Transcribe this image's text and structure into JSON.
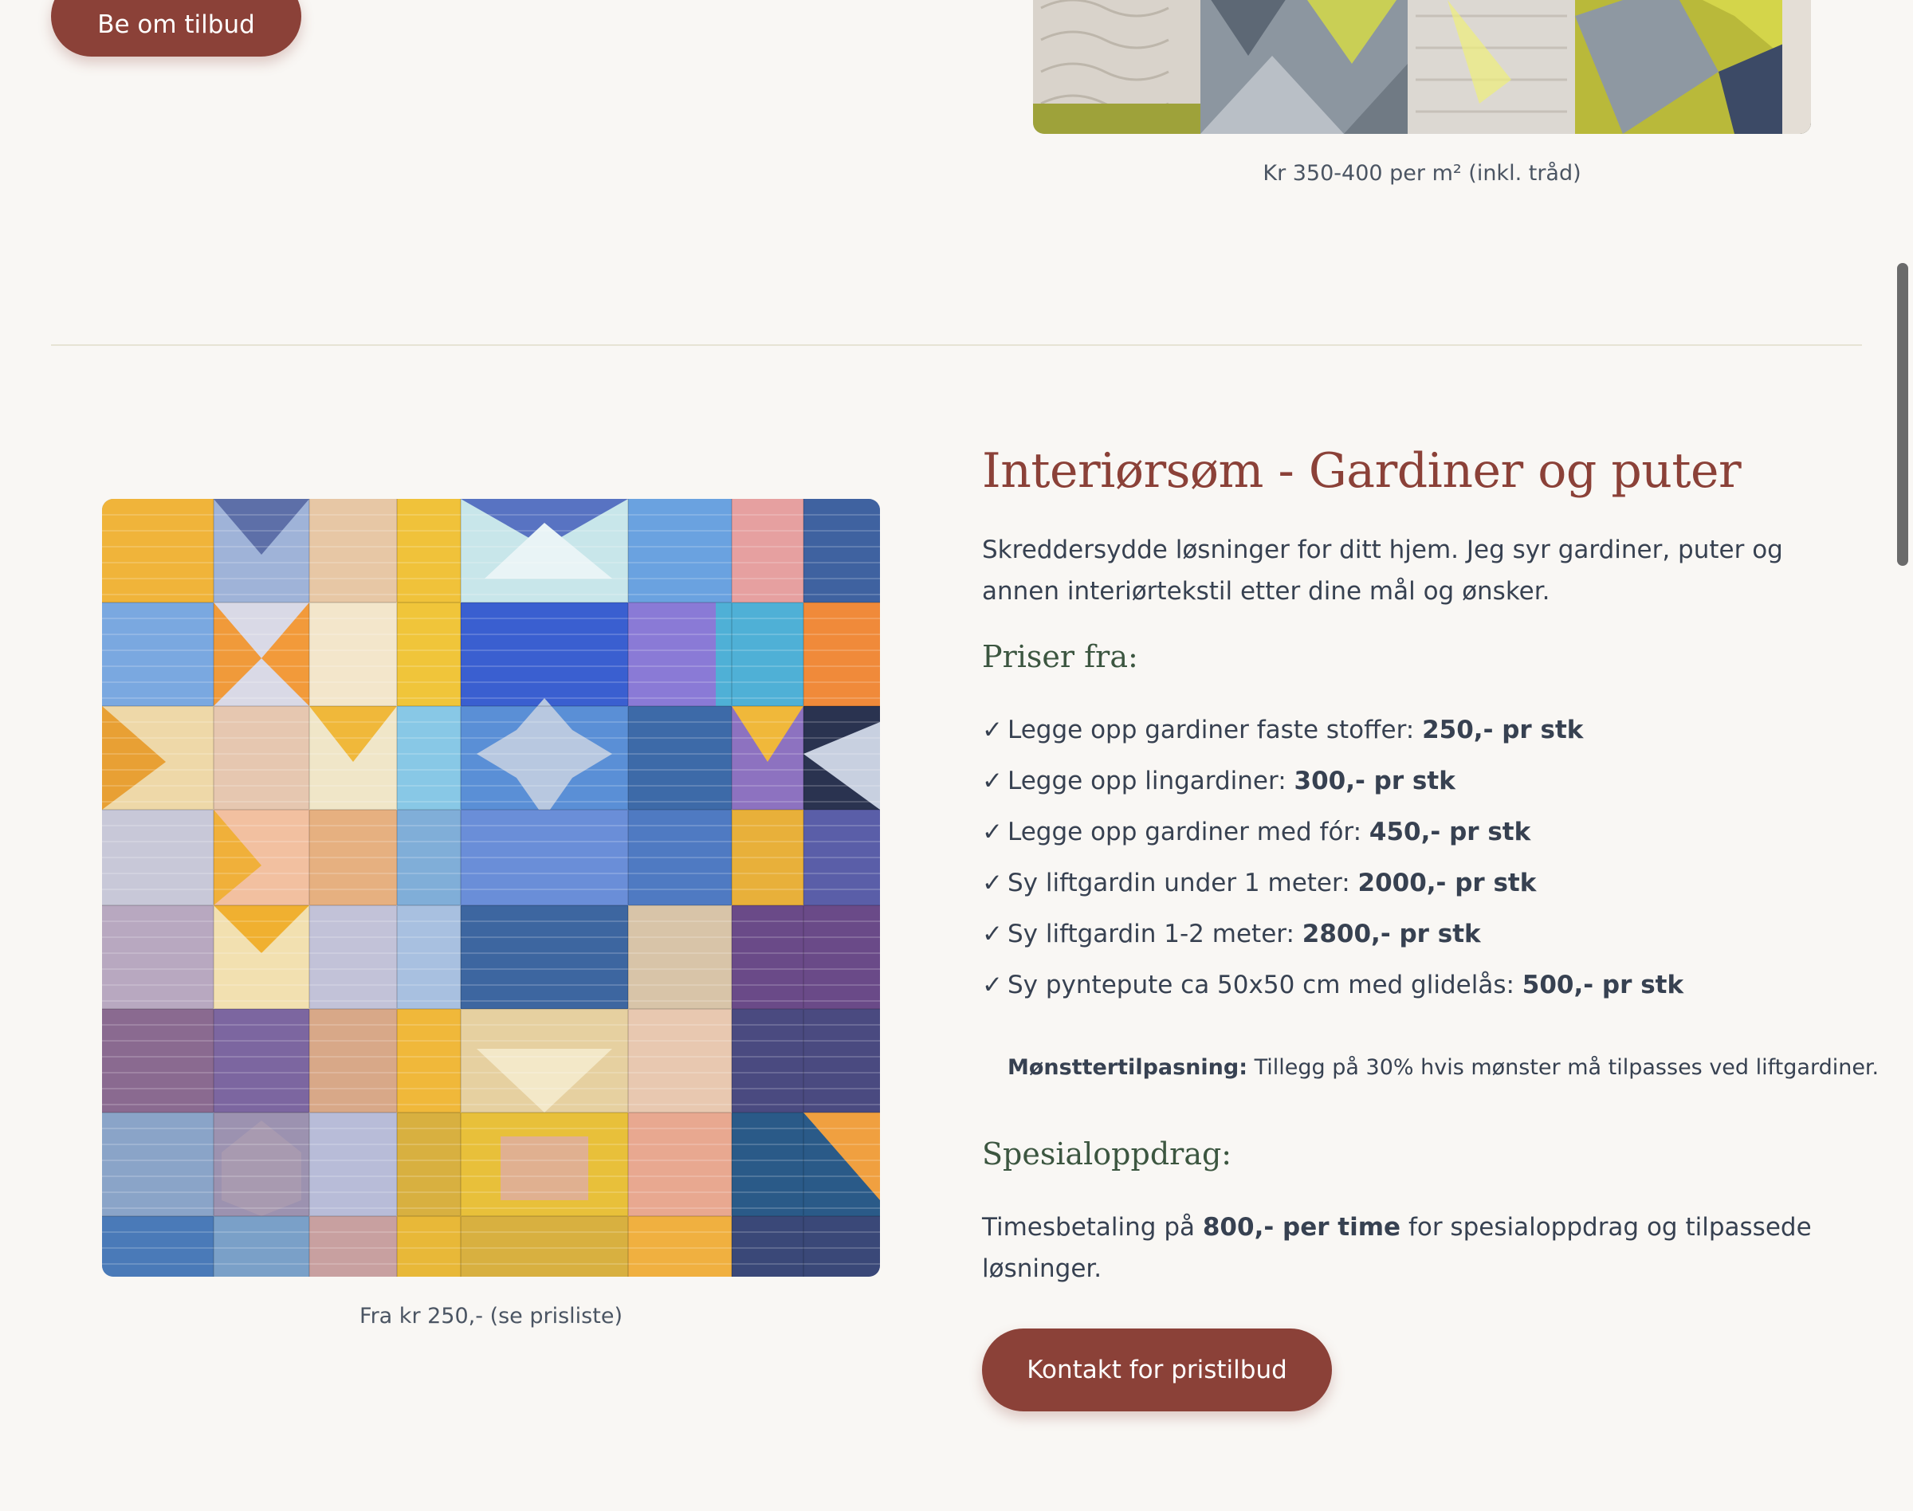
{
  "top_section": {
    "quote_button": "Be om tilbud",
    "image_caption": "Kr 350-400 per m² (inkl. tråd)"
  },
  "interior_section": {
    "title": "Interiørsøm - Gardiner og puter",
    "description": "Skreddersydde løsninger for ditt hjem. Jeg syr gardiner, puter og annen interiørtekstil etter dine mål og ønsker.",
    "prices_heading": "Priser fra:",
    "check_mark": "✓",
    "prices": [
      {
        "label": "Legge opp gardiner faste stoffer:",
        "price": "250,- pr stk"
      },
      {
        "label": "Legge opp lingardiner:",
        "price": "300,- pr stk"
      },
      {
        "label": "Legge opp gardiner med fór:",
        "price": "450,- pr stk"
      },
      {
        "label": "Sy liftgardin under 1 meter:",
        "price": "2000,- pr stk"
      },
      {
        "label": "Sy liftgardin 1-2 meter:",
        "price": "2800,- pr stk"
      },
      {
        "label": "Sy pyntepute ca 50x50 cm med glidelås:",
        "price": "500,- pr stk"
      }
    ],
    "note_label": "Mønsttertilpasning:",
    "note_text": "Tillegg på 30% hvis mønster må tilpasses ved liftgardiner.",
    "special_heading": "Spesialoppdrag:",
    "special_prefix": "Timesbetaling på",
    "special_price": "800,- per time",
    "special_suffix": "for spesialoppdrag og tilpassede løsninger.",
    "contact_button": "Kontakt for pristilbud",
    "image_caption": "Fra kr 250,- (se prisliste)"
  },
  "colors": {
    "background": "#f9f7f4",
    "accent": "#8b4138",
    "subheading": "#3c5640",
    "text": "#374151"
  }
}
